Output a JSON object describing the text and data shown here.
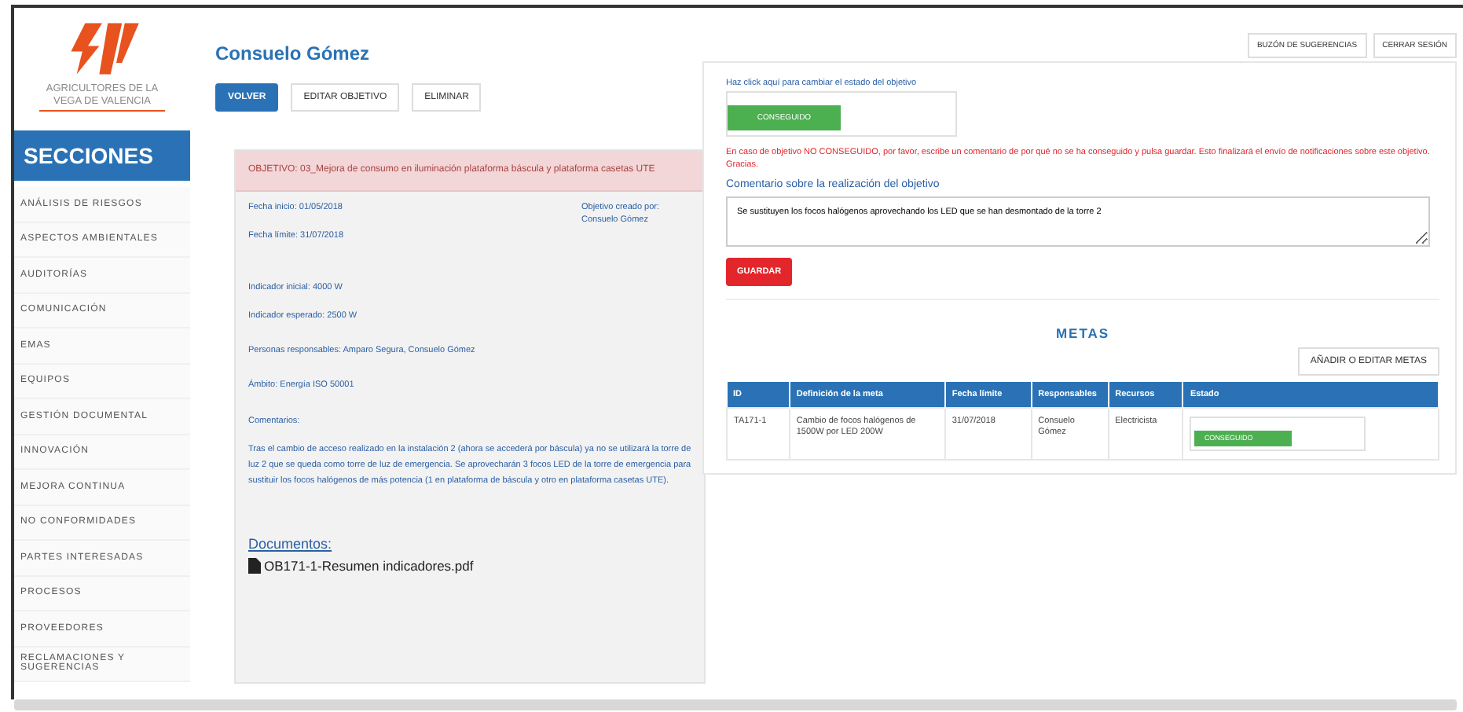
{
  "logo": {
    "caption": "AGRICULTORES DE LA VEGA DE VALENCIA"
  },
  "sidebar": {
    "title": "SECCIONES",
    "items": [
      "ANÁLISIS DE RIESGOS",
      "ASPECTOS AMBIENTALES",
      "AUDITORÍAS",
      "COMUNICACIÓN",
      "EMAS",
      "EQUIPOS",
      "GESTIÓN DOCUMENTAL",
      "INNOVACIÓN",
      "MEJORA CONTINUA",
      "NO CONFORMIDADES",
      "PARTES INTERESADAS",
      "PROCESOS",
      "PROVEEDORES",
      "RECLAMACIONES Y SUGERENCIAS"
    ]
  },
  "user": "Consuelo Gómez",
  "actions": [
    {
      "label": "VOLVER",
      "primary": true
    },
    {
      "label": "EDITAR OBJETIVO",
      "primary": false
    },
    {
      "label": "ELIMINAR",
      "primary": false
    }
  ],
  "top_buttons": [
    "BUZÓN DE SUGERENCIAS",
    "CERRAR SESIÓN"
  ],
  "objective": {
    "title": "OBJETIVO: 03_Mejora de consumo en iluminación plataforma báscula y plataforma casetas UTE",
    "dates": [
      "Fecha inicio: 01/05/2018",
      "Fecha límite: 31/07/2018"
    ],
    "created_by": "Objetivo creado por: Consuelo Gómez",
    "indicators": [
      "Indicador inicial: 4000 W",
      "Indicador esperado: 2500 W"
    ],
    "responsables": "Personas responsables: Amparo Segura, Consuelo Gómez",
    "scope": "Ámbito: Energía ISO 50001",
    "comments_label": "Comentarios:",
    "comments": "Tras el cambio de acceso realizado en la instalación 2 (ahora se accederá por báscula) ya no se utilizará la torre de luz 2 que se queda como torre de luz de emergencia. Se aprovecharán 3 focos LED de la torre de emergencia para sustituir los focos halógenos de más potencia (1 en plataforma de báscula y otro en plataforma casetas UTE).",
    "documents_label": "Documentos:",
    "documents": [
      "OB171-1-Resumen indicadores.pdf"
    ]
  },
  "status_panel": {
    "hint": "Haz click aquí para cambiar el estado del objetivo",
    "status": "CONSEGUIDO",
    "warning": "En caso de objetivo NO CONSEGUIDO, por favor, escribe un comentario de por qué no se ha conseguido y pulsa guardar. Esto finalizará el envío de notificaciones sobre este objetivo. Gracias.",
    "comment_label": "Comentario sobre la realización del objetivo",
    "comment": "Se sustituyen los focos halógenos aprovechando los LED que se han desmontado de la torre 2",
    "save": "GUARDAR"
  },
  "goals": {
    "title": "METAS",
    "edit": "AÑADIR O EDITAR METAS",
    "columns": [
      "ID",
      "Definición de la meta",
      "Fecha límite",
      "Responsables",
      "Recursos",
      "Estado"
    ],
    "rows": [
      {
        "id": "TA171-1",
        "definition": "Cambio de focos halógenos de 1500W por LED 200W",
        "deadline": "31/07/2018",
        "responsables": "Consuelo Gómez",
        "resources": "Electricista",
        "status": "CONSEGUIDO"
      }
    ]
  }
}
